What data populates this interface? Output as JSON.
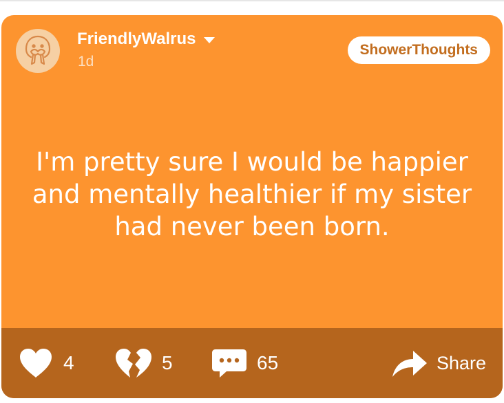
{
  "post": {
    "username": "FriendlyWalrus",
    "time": "1d",
    "tag": "ShowerThoughts",
    "text": "I'm pretty sure I would be happier and mentally healthier if my sister had never been born.",
    "colors": {
      "card": "#fd942f",
      "actions_bar": "#b5651d",
      "tag_text": "#c26d1e"
    },
    "avatar_icon": "walrus-icon"
  },
  "actions": {
    "likes": "4",
    "dislikes": "5",
    "comments": "65",
    "share_label": "Share"
  }
}
